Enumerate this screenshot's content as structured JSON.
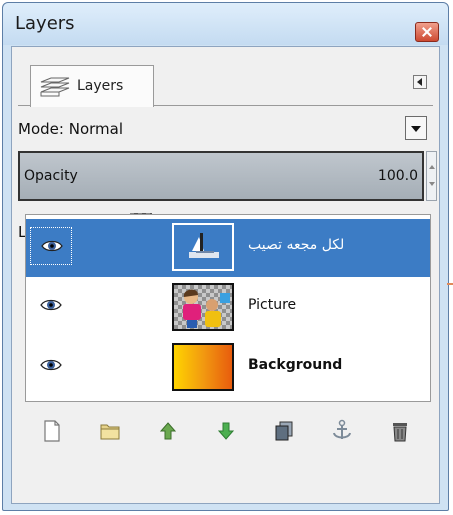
{
  "window": {
    "title": "Layers"
  },
  "tab": {
    "label": "Layers"
  },
  "mode": {
    "label": "Mode:",
    "value": "Normal"
  },
  "opacity": {
    "label": "Opacity",
    "value": "100.0"
  },
  "lock": {
    "label": "Lock:"
  },
  "layers": [
    {
      "name": "لکل مجعه تصیب",
      "visible": true,
      "selected": true
    },
    {
      "name": "Picture",
      "visible": true,
      "selected": false
    },
    {
      "name": "Background",
      "visible": true,
      "selected": false,
      "bold": true
    }
  ],
  "toolbar": {
    "buttons": [
      "new-layer-icon",
      "new-layer-group-icon",
      "raise-layer-icon",
      "lower-layer-icon",
      "duplicate-layer-icon",
      "anchor-layer-icon",
      "delete-layer-icon"
    ]
  },
  "colors": {
    "selection": "#3c7cc5",
    "window_frame": "#cfe2f3",
    "close_button": "#cd4a32",
    "background_gradient_start": "#ffd400",
    "background_gradient_end": "#e85c0d"
  }
}
